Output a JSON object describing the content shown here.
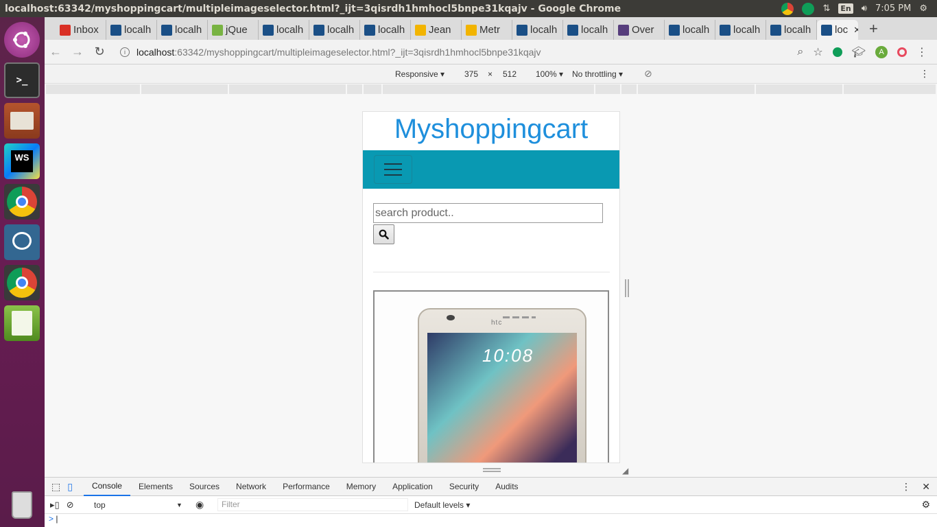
{
  "window": {
    "title": "localhost:63342/myshoppingcart/multipleimageselector.html?_ijt=3qisrdh1hmhocl5bnpe31kqajv - Google Chrome"
  },
  "system": {
    "lang": "En",
    "time": "7:05 PM"
  },
  "tabs": [
    {
      "label": "Inbox",
      "icon": "gmail-icon",
      "color": "#d93025"
    },
    {
      "label": "localh",
      "icon": "webstorm-icon",
      "color": "#1a4f86"
    },
    {
      "label": "localh",
      "icon": "webstorm-icon",
      "color": "#1a4f86"
    },
    {
      "label": "jQue",
      "icon": "jquery-icon",
      "color": "#78b342"
    },
    {
      "label": "localh",
      "icon": "webstorm-icon",
      "color": "#1a4f86"
    },
    {
      "label": "localh",
      "icon": "webstorm-icon",
      "color": "#1a4f86"
    },
    {
      "label": "localh",
      "icon": "webstorm-icon",
      "color": "#1a4f86"
    },
    {
      "label": "Jean",
      "icon": "doc-icon",
      "color": "#f2b400"
    },
    {
      "label": "Metr",
      "icon": "doc-icon",
      "color": "#f2b400"
    },
    {
      "label": "localh",
      "icon": "webstorm-icon",
      "color": "#1a4f86"
    },
    {
      "label": "localh",
      "icon": "webstorm-icon",
      "color": "#1a4f86"
    },
    {
      "label": "Over",
      "icon": "bootstrap-icon",
      "color": "#563d7c"
    },
    {
      "label": "localh",
      "icon": "webstorm-icon",
      "color": "#1a4f86"
    },
    {
      "label": "localh",
      "icon": "webstorm-icon",
      "color": "#1a4f86"
    },
    {
      "label": "localh",
      "icon": "webstorm-icon",
      "color": "#1a4f86"
    }
  ],
  "active_tab": {
    "label": "loc"
  },
  "address": {
    "host": "localhost",
    "rest": ":63342/myshoppingcart/multipleimageselector.html?_ijt=3qisrdh1hmhocl5bnpe31kqajv"
  },
  "profile": {
    "initial": "A"
  },
  "device_toolbar": {
    "mode": "Responsive",
    "width": "375",
    "times": "×",
    "height": "512",
    "zoom": "100%",
    "throttling": "No throttling"
  },
  "page": {
    "brand": "Myshoppingcart",
    "search_placeholder": "search product..",
    "phone_brand": "htc",
    "phone_clock": "10:08"
  },
  "devtools": {
    "tabs": [
      "Console",
      "Elements",
      "Sources",
      "Network",
      "Performance",
      "Memory",
      "Application",
      "Security",
      "Audits"
    ],
    "context": "top",
    "filter_placeholder": "Filter",
    "levels": "Default levels",
    "prompt": ">"
  },
  "colors": {
    "navbar": "#0999b2",
    "brand": "#1e8fdc",
    "launcher": "#6a1d54"
  }
}
